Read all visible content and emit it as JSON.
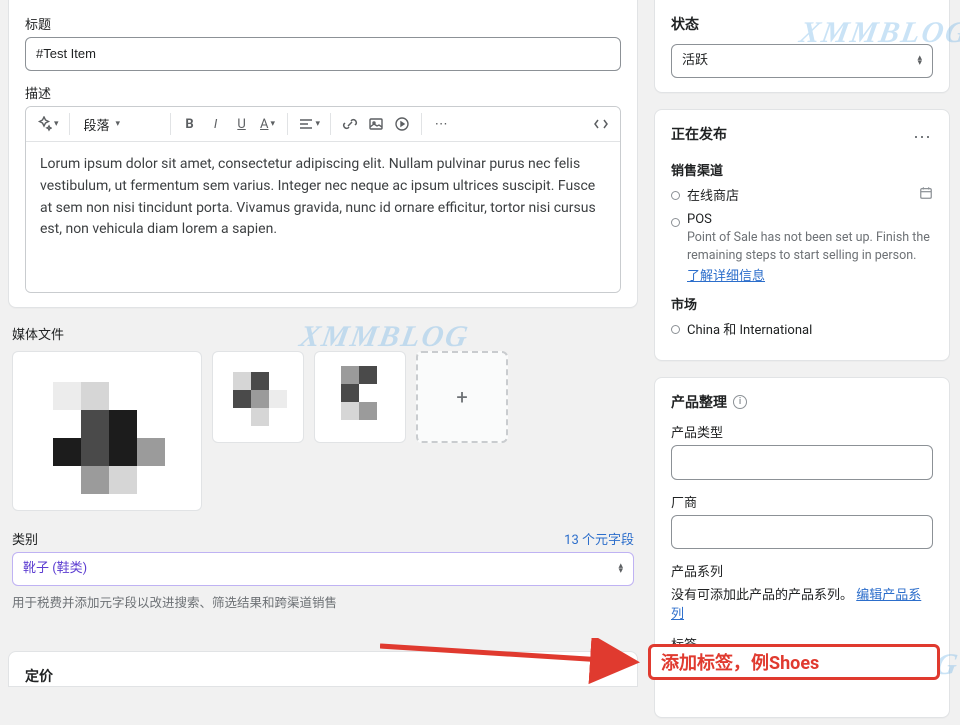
{
  "title_section": {
    "label": "标题",
    "value": "#Test Item"
  },
  "description_section": {
    "label": "描述",
    "paragraph_dropdown": "段落",
    "body": "Lorum ipsum dolor sit amet, consectetur adipiscing elit. Nullam pulvinar purus nec felis vestibulum, ut fermentum sem varius. Integer nec neque ac ipsum ultrices suscipit. Fusce at sem non nisi tincidunt porta. Vivamus gravida, nunc id ornare efficitur, tortor nisi cursus est, non vehicula diam lorem a sapien."
  },
  "media_section": {
    "label": "媒体文件",
    "add_label": "+"
  },
  "category_section": {
    "label": "类别",
    "metafields_link": "13 个元字段",
    "value": "靴子 (鞋类)",
    "help": "用于税费并添加元字段以改进搜索、筛选结果和跨渠道销售"
  },
  "pricing_section": {
    "label": "定价"
  },
  "status_card": {
    "title": "状态",
    "value": "活跃"
  },
  "publishing_card": {
    "title": "正在发布",
    "channels_label": "销售渠道",
    "channel_online": "在线商店",
    "channel_pos": "POS",
    "pos_note": "Point of Sale has not been set up. Finish the remaining steps to start selling in person.",
    "pos_link": "了解详细信息",
    "markets_label": "市场",
    "markets_value": "China 和 International"
  },
  "organize_card": {
    "title": "产品整理",
    "type_label": "产品类型",
    "vendor_label": "厂商",
    "collections_label": "产品系列",
    "collections_empty": "没有可添加此产品的产品系列。",
    "collections_link": "编辑产品系列",
    "tags_label": "标签",
    "tags_callout": "添加标签，例Shoes"
  },
  "watermark": "XMMBLOG"
}
